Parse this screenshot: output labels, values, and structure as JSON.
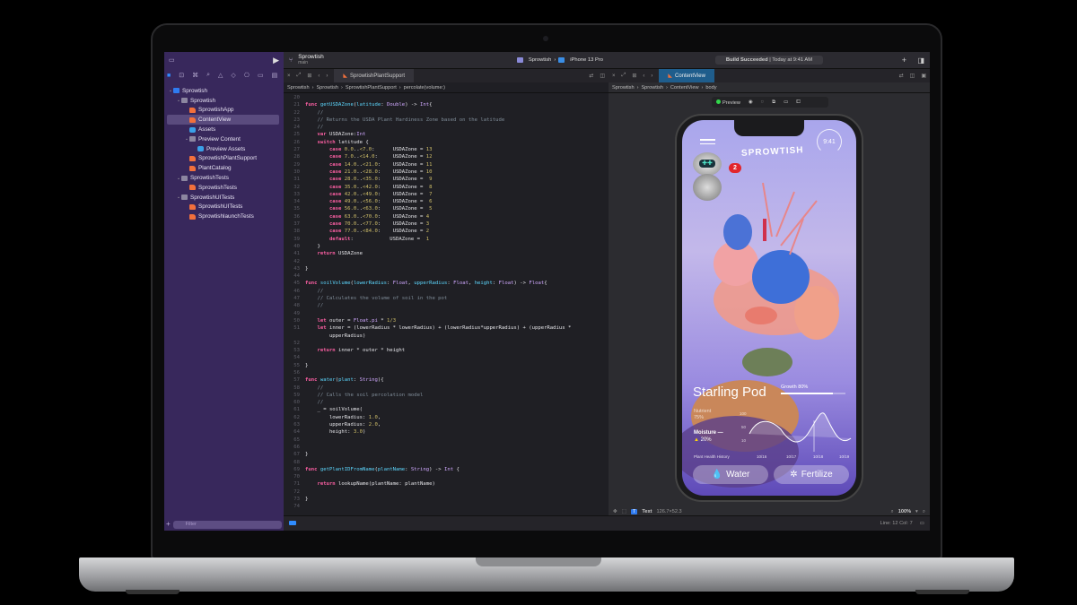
{
  "toolbar": {
    "project": "Sprowtish",
    "branch": "main",
    "scheme": "Sprowtish",
    "device": "iPhone 13 Pro",
    "build_status": "Build Succeeded",
    "build_time": "Today at 9:41 AM"
  },
  "sidebar": {
    "items": [
      {
        "label": "Sprowtish",
        "level": 0,
        "icon": "project",
        "disclosure": "open"
      },
      {
        "label": "Sprowtish",
        "level": 1,
        "icon": "folder",
        "disclosure": "open"
      },
      {
        "label": "SprowtishApp",
        "level": 2,
        "icon": "swift"
      },
      {
        "label": "ContentView",
        "level": 2,
        "icon": "swift",
        "selected": true
      },
      {
        "label": "Assets",
        "level": 2,
        "icon": "assets"
      },
      {
        "label": "Preview Content",
        "level": 2,
        "icon": "folder",
        "disclosure": "open"
      },
      {
        "label": "Preview Assets",
        "level": 3,
        "icon": "assets"
      },
      {
        "label": "SprowtishPlantSupport",
        "level": 2,
        "icon": "swift"
      },
      {
        "label": "PlantCatalog",
        "level": 2,
        "icon": "swift"
      },
      {
        "label": "SprowtishTests",
        "level": 1,
        "icon": "folder",
        "disclosure": "open"
      },
      {
        "label": "SprowtishTests",
        "level": 2,
        "icon": "swift"
      },
      {
        "label": "SprowtishUITests",
        "level": 1,
        "icon": "folder",
        "disclosure": "open"
      },
      {
        "label": "SprowtishUITests",
        "level": 2,
        "icon": "swift"
      },
      {
        "label": "SprowtishlaunchTests",
        "level": 2,
        "icon": "swift"
      }
    ],
    "filter_placeholder": "Filter"
  },
  "editor": {
    "tab": "SprowtishPlantSupport",
    "breadcrumb": [
      "Sprowtish",
      "Sprowtish",
      "SprowtishPlantSupport",
      "percolate(volume:)"
    ],
    "lines": [
      {
        "n": "20",
        "tokens": []
      },
      {
        "n": "21",
        "tokens": [
          [
            "k",
            "func "
          ],
          [
            "f",
            "getUSDAZone"
          ],
          [
            "p",
            "("
          ],
          [
            "f",
            "latitude"
          ],
          [
            "p",
            ": "
          ],
          [
            "t",
            "Double"
          ],
          [
            "p",
            ") -> "
          ],
          [
            "t",
            "Int"
          ],
          [
            "p",
            "{"
          ]
        ]
      },
      {
        "n": "22",
        "tokens": [
          [
            "c",
            "    //"
          ]
        ]
      },
      {
        "n": "23",
        "tokens": [
          [
            "c",
            "    // Returns the USDA Plant Hardiness Zone based on the latitude"
          ]
        ]
      },
      {
        "n": "24",
        "tokens": [
          [
            "c",
            "    //"
          ]
        ]
      },
      {
        "n": "25",
        "tokens": [
          [
            "k",
            "    var "
          ],
          [
            "p",
            "USDAZone:"
          ],
          [
            "t",
            "Int"
          ]
        ]
      },
      {
        "n": "26",
        "tokens": [
          [
            "k",
            "    switch "
          ],
          [
            "p",
            "latitude {"
          ]
        ]
      },
      {
        "n": "27",
        "tokens": [
          [
            "k",
            "        case "
          ],
          [
            "n",
            "0.0"
          ],
          [
            "p",
            ".."
          ],
          [
            "n",
            "<7.0"
          ],
          [
            "p",
            ":      USDAZone = "
          ],
          [
            "n",
            "13"
          ]
        ]
      },
      {
        "n": "28",
        "tokens": [
          [
            "k",
            "        case "
          ],
          [
            "n",
            "7.0"
          ],
          [
            "p",
            ".."
          ],
          [
            "n",
            "<14.0"
          ],
          [
            "p",
            ":     USDAZone = "
          ],
          [
            "n",
            "12"
          ]
        ]
      },
      {
        "n": "29",
        "tokens": [
          [
            "k",
            "        case "
          ],
          [
            "n",
            "14.0"
          ],
          [
            "p",
            ".."
          ],
          [
            "n",
            "<21.0"
          ],
          [
            "p",
            ":    USDAZone = "
          ],
          [
            "n",
            "11"
          ]
        ]
      },
      {
        "n": "30",
        "tokens": [
          [
            "k",
            "        case "
          ],
          [
            "n",
            "21.0"
          ],
          [
            "p",
            ".."
          ],
          [
            "n",
            "<28.0"
          ],
          [
            "p",
            ":    USDAZone = "
          ],
          [
            "n",
            "10"
          ]
        ]
      },
      {
        "n": "31",
        "tokens": [
          [
            "k",
            "        case "
          ],
          [
            "n",
            "28.0"
          ],
          [
            "p",
            ".."
          ],
          [
            "n",
            "<35.0"
          ],
          [
            "p",
            ":    USDAZone =  "
          ],
          [
            "n",
            "9"
          ]
        ]
      },
      {
        "n": "32",
        "tokens": [
          [
            "k",
            "        case "
          ],
          [
            "n",
            "35.0"
          ],
          [
            "p",
            ".."
          ],
          [
            "n",
            "<42.0"
          ],
          [
            "p",
            ":    USDAZone =  "
          ],
          [
            "n",
            "8"
          ]
        ]
      },
      {
        "n": "33",
        "tokens": [
          [
            "k",
            "        case "
          ],
          [
            "n",
            "42.0"
          ],
          [
            "p",
            ".."
          ],
          [
            "n",
            "<49.0"
          ],
          [
            "p",
            ":    USDAZone =  "
          ],
          [
            "n",
            "7"
          ]
        ]
      },
      {
        "n": "34",
        "tokens": [
          [
            "k",
            "        case "
          ],
          [
            "n",
            "49.0"
          ],
          [
            "p",
            ".."
          ],
          [
            "n",
            "<56.0"
          ],
          [
            "p",
            ":    USDAZone =  "
          ],
          [
            "n",
            "6"
          ]
        ]
      },
      {
        "n": "35",
        "tokens": [
          [
            "k",
            "        case "
          ],
          [
            "n",
            "56.0"
          ],
          [
            "p",
            ".."
          ],
          [
            "n",
            "<63.0"
          ],
          [
            "p",
            ":    USDAZone =  "
          ],
          [
            "n",
            "5"
          ]
        ]
      },
      {
        "n": "36",
        "tokens": [
          [
            "k",
            "        case "
          ],
          [
            "n",
            "63.0"
          ],
          [
            "p",
            ".."
          ],
          [
            "n",
            "<70.0"
          ],
          [
            "p",
            ":    USDAZone = "
          ],
          [
            "n",
            "4"
          ]
        ]
      },
      {
        "n": "37",
        "tokens": [
          [
            "k",
            "        case "
          ],
          [
            "n",
            "70.0"
          ],
          [
            "p",
            ".."
          ],
          [
            "n",
            "<77.0"
          ],
          [
            "p",
            ":    USDAZone = "
          ],
          [
            "n",
            "3"
          ]
        ]
      },
      {
        "n": "38",
        "tokens": [
          [
            "k",
            "        case "
          ],
          [
            "n",
            "77.0"
          ],
          [
            "p",
            ".."
          ],
          [
            "n",
            "<84.0"
          ],
          [
            "p",
            ":    USDAZone = "
          ],
          [
            "n",
            "2"
          ]
        ]
      },
      {
        "n": "39",
        "tokens": [
          [
            "k",
            "        default"
          ],
          [
            "p",
            ":            USDAZone =  "
          ],
          [
            "n",
            "1"
          ]
        ]
      },
      {
        "n": "40",
        "tokens": [
          [
            "p",
            "    }"
          ]
        ]
      },
      {
        "n": "41",
        "tokens": [
          [
            "k",
            "    return "
          ],
          [
            "p",
            "USDAZone"
          ]
        ]
      },
      {
        "n": "42",
        "tokens": []
      },
      {
        "n": "43",
        "tokens": [
          [
            "p",
            "}"
          ]
        ]
      },
      {
        "n": "44",
        "tokens": []
      },
      {
        "n": "45",
        "tokens": [
          [
            "k",
            "func "
          ],
          [
            "f",
            "soilVolume"
          ],
          [
            "p",
            "("
          ],
          [
            "f",
            "lowerRadius"
          ],
          [
            "p",
            ": "
          ],
          [
            "t",
            "Float"
          ],
          [
            "p",
            ", "
          ],
          [
            "f",
            "upperRadius"
          ],
          [
            "p",
            ": "
          ],
          [
            "t",
            "Float"
          ],
          [
            "p",
            ", "
          ],
          [
            "f",
            "height"
          ],
          [
            "p",
            ": "
          ],
          [
            "t",
            "Float"
          ],
          [
            "p",
            ") -> "
          ],
          [
            "t",
            "Float"
          ],
          [
            "p",
            "{"
          ]
        ]
      },
      {
        "n": "46",
        "tokens": [
          [
            "c",
            "    //"
          ]
        ]
      },
      {
        "n": "47",
        "tokens": [
          [
            "c",
            "    // Calculates the volume of soil in the pot"
          ]
        ]
      },
      {
        "n": "48",
        "tokens": [
          [
            "c",
            "    //"
          ]
        ]
      },
      {
        "n": "49",
        "tokens": []
      },
      {
        "n": "50",
        "tokens": [
          [
            "k",
            "    let "
          ],
          [
            "p",
            "outer = "
          ],
          [
            "t",
            "Float"
          ],
          [
            "p",
            "."
          ],
          [
            "t",
            "pi"
          ],
          [
            "p",
            " * "
          ],
          [
            "n",
            "1/3"
          ]
        ]
      },
      {
        "n": "51",
        "tokens": [
          [
            "k",
            "    let "
          ],
          [
            "p",
            "inner = (lowerRadius * lowerRadius) + (lowerRadius*upperRadius) + (upperRadius *"
          ]
        ]
      },
      {
        "n": "",
        "tokens": [
          [
            "p",
            "        upperRadius)"
          ]
        ]
      },
      {
        "n": "52",
        "tokens": []
      },
      {
        "n": "53",
        "tokens": [
          [
            "k",
            "    return "
          ],
          [
            "p",
            "inner * outer * height"
          ]
        ]
      },
      {
        "n": "54",
        "tokens": []
      },
      {
        "n": "55",
        "tokens": [
          [
            "p",
            "}"
          ]
        ]
      },
      {
        "n": "56",
        "tokens": []
      },
      {
        "n": "57",
        "tokens": [
          [
            "k",
            "func "
          ],
          [
            "f",
            "water"
          ],
          [
            "p",
            "("
          ],
          [
            "f",
            "plant"
          ],
          [
            "p",
            ": "
          ],
          [
            "t",
            "String"
          ],
          [
            "p",
            "){"
          ]
        ]
      },
      {
        "n": "58",
        "tokens": [
          [
            "c",
            "    //"
          ]
        ]
      },
      {
        "n": "59",
        "tokens": [
          [
            "c",
            "    // Calls the soil percolation model"
          ]
        ]
      },
      {
        "n": "60",
        "tokens": [
          [
            "c",
            "    //"
          ]
        ]
      },
      {
        "n": "61",
        "tokens": [
          [
            "p",
            "    _ = soilVolume("
          ]
        ]
      },
      {
        "n": "62",
        "tokens": [
          [
            "p",
            "        lowerRadius: "
          ],
          [
            "n",
            "1.0"
          ],
          [
            "p",
            ","
          ]
        ]
      },
      {
        "n": "63",
        "tokens": [
          [
            "p",
            "        upperRadius: "
          ],
          [
            "n",
            "2.0"
          ],
          [
            "p",
            ","
          ]
        ]
      },
      {
        "n": "64",
        "tokens": [
          [
            "p",
            "        height: "
          ],
          [
            "n",
            "3.0"
          ],
          [
            "p",
            ")"
          ]
        ]
      },
      {
        "n": "65",
        "tokens": []
      },
      {
        "n": "66",
        "tokens": []
      },
      {
        "n": "67",
        "tokens": [
          [
            "p",
            "}"
          ]
        ]
      },
      {
        "n": "68",
        "tokens": []
      },
      {
        "n": "69",
        "tokens": [
          [
            "k",
            "func "
          ],
          [
            "f",
            "getPlantIDFromName"
          ],
          [
            "p",
            "("
          ],
          [
            "f",
            "plantName"
          ],
          [
            "p",
            ": "
          ],
          [
            "t",
            "String"
          ],
          [
            "p",
            ") -> "
          ],
          [
            "t",
            "Int"
          ],
          [
            "p",
            " {"
          ]
        ]
      },
      {
        "n": "70",
        "tokens": []
      },
      {
        "n": "71",
        "tokens": [
          [
            "k",
            "    return "
          ],
          [
            "p",
            "lookupName(plantName: plantName)"
          ]
        ]
      },
      {
        "n": "72",
        "tokens": []
      },
      {
        "n": "73",
        "tokens": [
          [
            "p",
            "}"
          ]
        ]
      },
      {
        "n": "74",
        "tokens": []
      }
    ]
  },
  "canvas": {
    "tab": "ContentView",
    "breadcrumb": [
      "Sprowtish",
      "Sprowtish",
      "ContentView",
      "body"
    ],
    "preview_label": "Preview",
    "selection_type": "Text",
    "selection_size": "126.7×52.3",
    "zoom": "100%",
    "cursor": "Line: 12  Col: 7"
  },
  "app": {
    "logo": "SPROWTISH",
    "time": "9:41",
    "badge": "2",
    "plant_name": "Starling Pod",
    "growth_label": "Growth 80%",
    "growth": 0.8,
    "nutrient_label": "Nutrient",
    "nutrient_value": "75%",
    "moisture_label": "Moisture —",
    "moisture_value": "20%",
    "y_ticks": [
      "100",
      "50",
      "10"
    ],
    "history_label": "Plant Health History",
    "dates": [
      "10/16",
      "10/17",
      "10/18",
      "10/19"
    ],
    "water_button": "Water",
    "fertilize_button": "Fertilize"
  },
  "colors": {
    "sidebar": "#38285c",
    "editor": "#1f1f24",
    "accent": "#2f7bf0",
    "keyword": "#fc5fa3",
    "number": "#d0bf69"
  }
}
